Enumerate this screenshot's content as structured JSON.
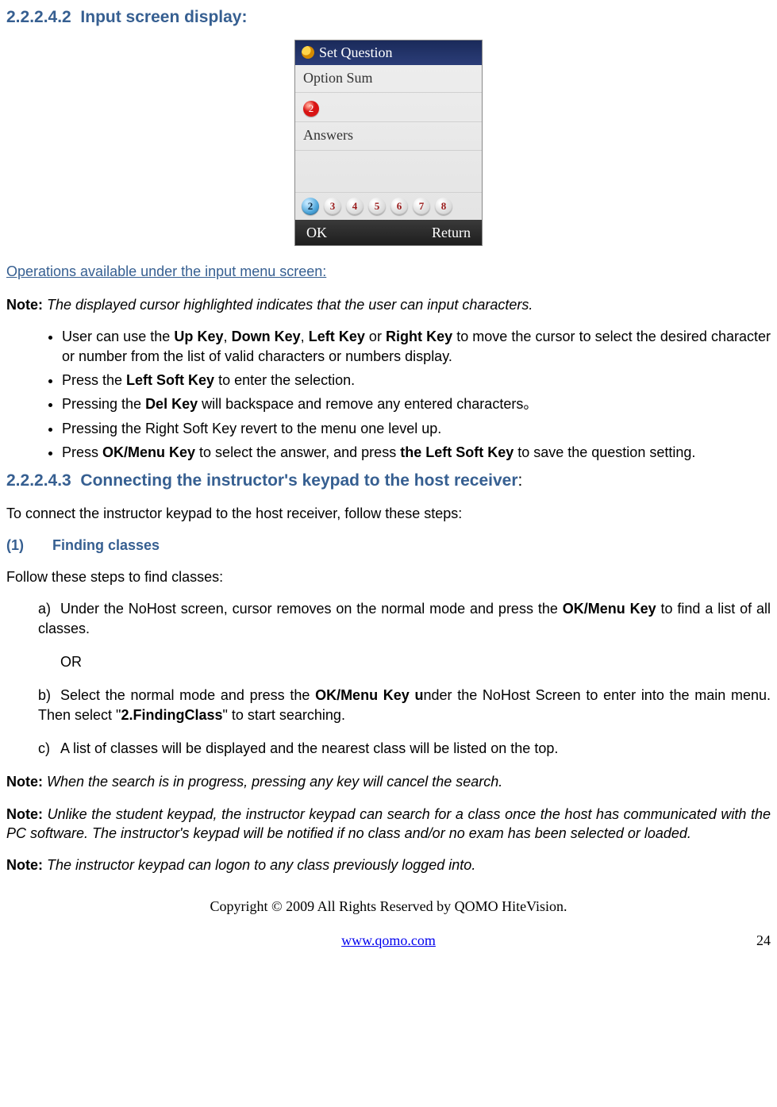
{
  "section1": {
    "num": "2.2.2.4.2",
    "title": "Input screen display:"
  },
  "device": {
    "header": "Set Question",
    "row1": "Option Sum",
    "badge": "2",
    "row2": "Answers",
    "numbers": [
      "2",
      "3",
      "4",
      "5",
      "6",
      "7",
      "8"
    ],
    "ok": "OK",
    "return": "Return"
  },
  "ops_link": "Operations available under the input menu screen:",
  "note1": {
    "label": "Note:",
    "body": "The displayed cursor highlighted indicates that the user can input characters."
  },
  "bullets": {
    "b1a": "User can use the ",
    "b1_up": "Up Key",
    "b1_c1": ", ",
    "b1_down": "Down Key",
    "b1_c2": ", ",
    "b1_left": "Left Key",
    "b1_or": " or ",
    "b1_right": "Right Key",
    "b1_tail": " to move the cursor to select the desired character or number from the list of valid characters or numbers display.",
    "b2a": "Press the ",
    "b2_left": "Left Soft Key",
    "b2_tail": " to enter the selection.",
    "b3a": "Pressing the ",
    "b3_del": "Del Key",
    "b3_tail": " will backspace and remove any entered characters。",
    "b4": "Pressing the Right Soft Key revert to the menu one level up.",
    "b5a": "Press ",
    "b5_ok": "OK/Menu Key",
    "b5_mid": " to select the answer, and press ",
    "b5_left": "the Left Soft Key",
    "b5_tail": " to save the question setting."
  },
  "section2": {
    "num": "2.2.2.4.3",
    "title": "Connecting the instructor's keypad to the host receiver",
    "colon": ":"
  },
  "sect2_intro": "To connect the instructor keypad to the host receiver, follow these steps:",
  "substep": {
    "num": "(1)",
    "title": "Finding classes"
  },
  "finding_intro": "Follow these steps to find classes:",
  "steps": {
    "a_let": "a)",
    "a_pre": "Under the NoHost screen, cursor removes on the normal mode and press the ",
    "a_bold": "OK/Menu Key",
    "a_tail": " to find a list of all classes.",
    "or": "OR",
    "b_let": "b)",
    "b_pre": "Select the normal mode and press the ",
    "b_bold1": "OK/Menu Key u",
    "b_mid": "nder the NoHost Screen to enter into the main menu. Then select \"",
    "b_bold2": "2.FindingClass",
    "b_tail": "\" to start searching.",
    "c_let": "c)",
    "c_body": "A list of classes will be displayed and the nearest class will be listed on the top."
  },
  "note2": {
    "label": "Note:",
    "body": "When the search is in progress, pressing any key will cancel the search."
  },
  "note3": {
    "label": "Note:",
    "body": "Unlike the student keypad, the instructor keypad can search for a class once the host has communicated with the PC software. The instructor's keypad will be notified if no class and/or no exam has been selected or loaded."
  },
  "note4": {
    "label": "Note:",
    "body": "The instructor keypad can logon to any class previously logged into."
  },
  "footer": {
    "copyright": "Copyright © 2009 All Rights Reserved by QOMO HiteVision.",
    "url": "www.qomo.com",
    "page": "24"
  }
}
